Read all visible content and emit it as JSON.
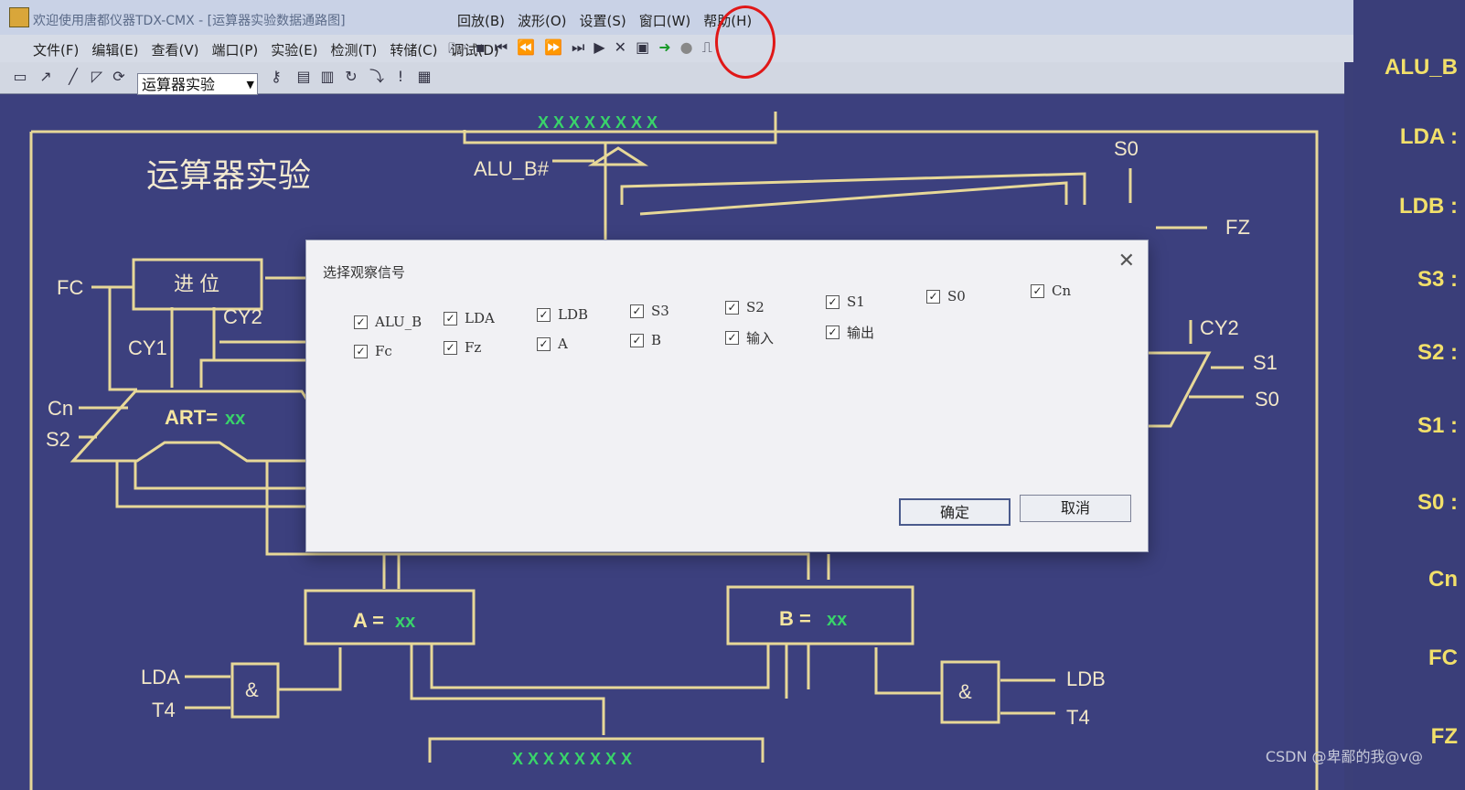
{
  "window": {
    "title": "欢迎使用唐都仪器TDX-CMX - [运算器实验数据通路图]",
    "menu_top": [
      "回放(B)",
      "波形(O)",
      "设置(S)",
      "窗口(W)",
      "帮助(H)"
    ],
    "menu": [
      "文件(F)",
      "编辑(E)",
      "查看(V)",
      "端口(P)",
      "实验(E)",
      "检测(T)",
      "转储(C)",
      "调试(D)"
    ]
  },
  "toolbar": {
    "experiment_select": "运算器实验",
    "icons": [
      "open-icon",
      "save-icon",
      "first-icon",
      "rewind-icon",
      "forward-icon",
      "last-icon",
      "play-icon",
      "stop-icon",
      "chart-icon",
      "run-icon",
      "record-icon",
      "waveform-icon"
    ]
  },
  "diagram": {
    "title": "运算器实验",
    "alu_b_label": "ALU_B#",
    "bus_top": "X X X X X X X X",
    "bus_bottom": "X X X X X X X X",
    "carry_block": "进 位",
    "fc": "FC",
    "cy1": "CY1",
    "cy2": "CY2",
    "cy2_right": "CY2",
    "cn": "Cn",
    "s2": "S2",
    "s0_top": "S0",
    "fz": "FZ",
    "s1_right": "S1",
    "s0_right": "S0",
    "art_label": "ART=",
    "art_value": "xx",
    "a_label": "A =",
    "a_value": "xx",
    "b_label": "B =",
    "b_value": "xx",
    "lda": "LDA",
    "ldb": "LDB",
    "t4_left": "T4",
    "t4_right": "T4",
    "and_gate": "&"
  },
  "side_panel": [
    "ALU_B",
    "LDA :",
    "LDB :",
    "S3 :",
    "S2 :",
    "S1 :",
    "S0 :",
    "Cn",
    "FC",
    "FZ"
  ],
  "dialog": {
    "title": "选择观察信号",
    "row1": [
      "ALU_B",
      "LDA",
      "LDB",
      "S3",
      "S2",
      "S1",
      "S0",
      "Cn"
    ],
    "row2": [
      "Fc",
      "Fz",
      "A",
      "B",
      "输入",
      "输出"
    ],
    "ok": "确定",
    "cancel": "取消"
  },
  "watermark": "CSDN @卑鄙的我@v@"
}
